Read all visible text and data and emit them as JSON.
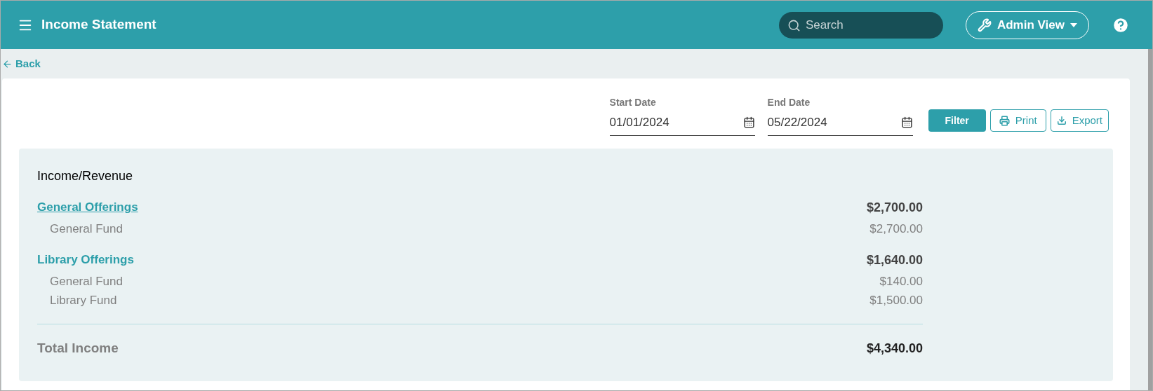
{
  "header": {
    "title": "Income Statement",
    "search": {
      "placeholder": "Search"
    },
    "view_button": "Admin View"
  },
  "back_link": "Back",
  "filters": {
    "start_date": {
      "label": "Start Date",
      "value": "01/01/2024"
    },
    "end_date": {
      "label": "End Date",
      "value": "05/22/2024"
    },
    "buttons": [
      {
        "kind": "primary",
        "label": "Filter"
      },
      {
        "kind": "print",
        "label": "Print"
      },
      {
        "kind": "export",
        "label": "Export"
      }
    ]
  },
  "report": {
    "section_title": "Income/Revenue",
    "groups": [
      {
        "name": "General Offerings",
        "hovered": true,
        "total": "$2,700.00",
        "items": [
          {
            "name": "General Fund",
            "amount": "$2,700.00"
          }
        ]
      },
      {
        "name": "Library Offerings",
        "hovered": false,
        "total": "$1,640.00",
        "items": [
          {
            "name": "General Fund",
            "amount": "$140.00"
          },
          {
            "name": "Library Fund",
            "amount": "$1,500.00"
          }
        ]
      }
    ],
    "total": {
      "label": "Total Income",
      "amount": "$4,340.00"
    }
  }
}
